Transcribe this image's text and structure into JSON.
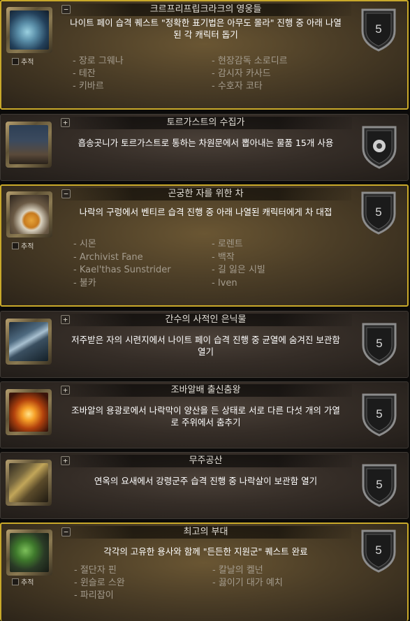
{
  "achievements": [
    {
      "title": "크르프리프립크라크의 영웅들",
      "toggle": "−",
      "description": "나이트 페이 습격 퀘스트 \"정확한 표기법은 아무도 몰라\" 진행 중 아래 나열된 각 캐릭터 돕기",
      "points": "5",
      "completed": true,
      "track_label": "추적",
      "icon": "fae-creature-icon",
      "criteria_left": [
        "- 장로 그웨나",
        "- 테잔",
        "- 키바르"
      ],
      "criteria_right": [
        "- 현장감독 소로디르",
        "- 감시자 카사드",
        "- 수호자 코타"
      ]
    },
    {
      "title": "토르가스트의 수집가",
      "toggle": "+",
      "description": "흡송곳니가 토르가스트로 통하는 차원문에서 뽑아내는 물품 15개 사용",
      "points": "",
      "completed": false,
      "icon": "torghast-tower-icon"
    },
    {
      "title": "곤궁한 자를 위한 차",
      "toggle": "−",
      "description": "나락의 구렁에서 벤티르 습격 진행 중 아래 나열된 캐릭터에게 차 대접",
      "points": "5",
      "completed": true,
      "track_label": "추적",
      "icon": "tea-cup-icon",
      "criteria_left": [
        "- 시몬",
        "- Archivist Fane",
        "- Kael'thas Sunstrider",
        "- 불카"
      ],
      "criteria_right": [
        "- 로렌트",
        "- 백작",
        "- 길 잃은 시빌",
        "- Iven"
      ]
    },
    {
      "title": "간수의 사적인 은닉물",
      "toggle": "+",
      "description": "저주받은 자의 시련지에서 나이트 페이 습격 진행 중 균열에 숨겨진 보관함 열기",
      "points": "5",
      "completed": false,
      "icon": "hidden-cache-icon"
    },
    {
      "title": "조바알배 출신춤왕",
      "toggle": "+",
      "description": "조바알의 용광로에서 나락막이 양산을 든 상태로 서로 다른 다섯 개의 가열로 주위에서 춤추기",
      "points": "5",
      "completed": false,
      "icon": "forge-fire-icon"
    },
    {
      "title": "무주공산",
      "toggle": "+",
      "description": "연옥의 요새에서 강령군주 습격 진행 중 나락살이 보관함 열기",
      "points": "5",
      "completed": false,
      "icon": "chest-icon"
    },
    {
      "title": "최고의 부대",
      "toggle": "−",
      "description": "각각의 고유한 용사와 함께 \"든든한 지원군\" 퀘스트 완료",
      "points": "5",
      "completed": true,
      "track_label": "추적",
      "icon": "goblin-warband-icon",
      "criteria_left": [
        "- 절단자 핀",
        "- 윈슬로 스완",
        "- 파리잡이"
      ],
      "criteria_right": [
        "- 칼날의 켈넌",
        "- 끓이기 대가 예치"
      ]
    }
  ],
  "colors": {
    "gold_border": "#c9a92a",
    "criteria_text": "#a49c8e",
    "title_text": "#e4e0d8"
  }
}
